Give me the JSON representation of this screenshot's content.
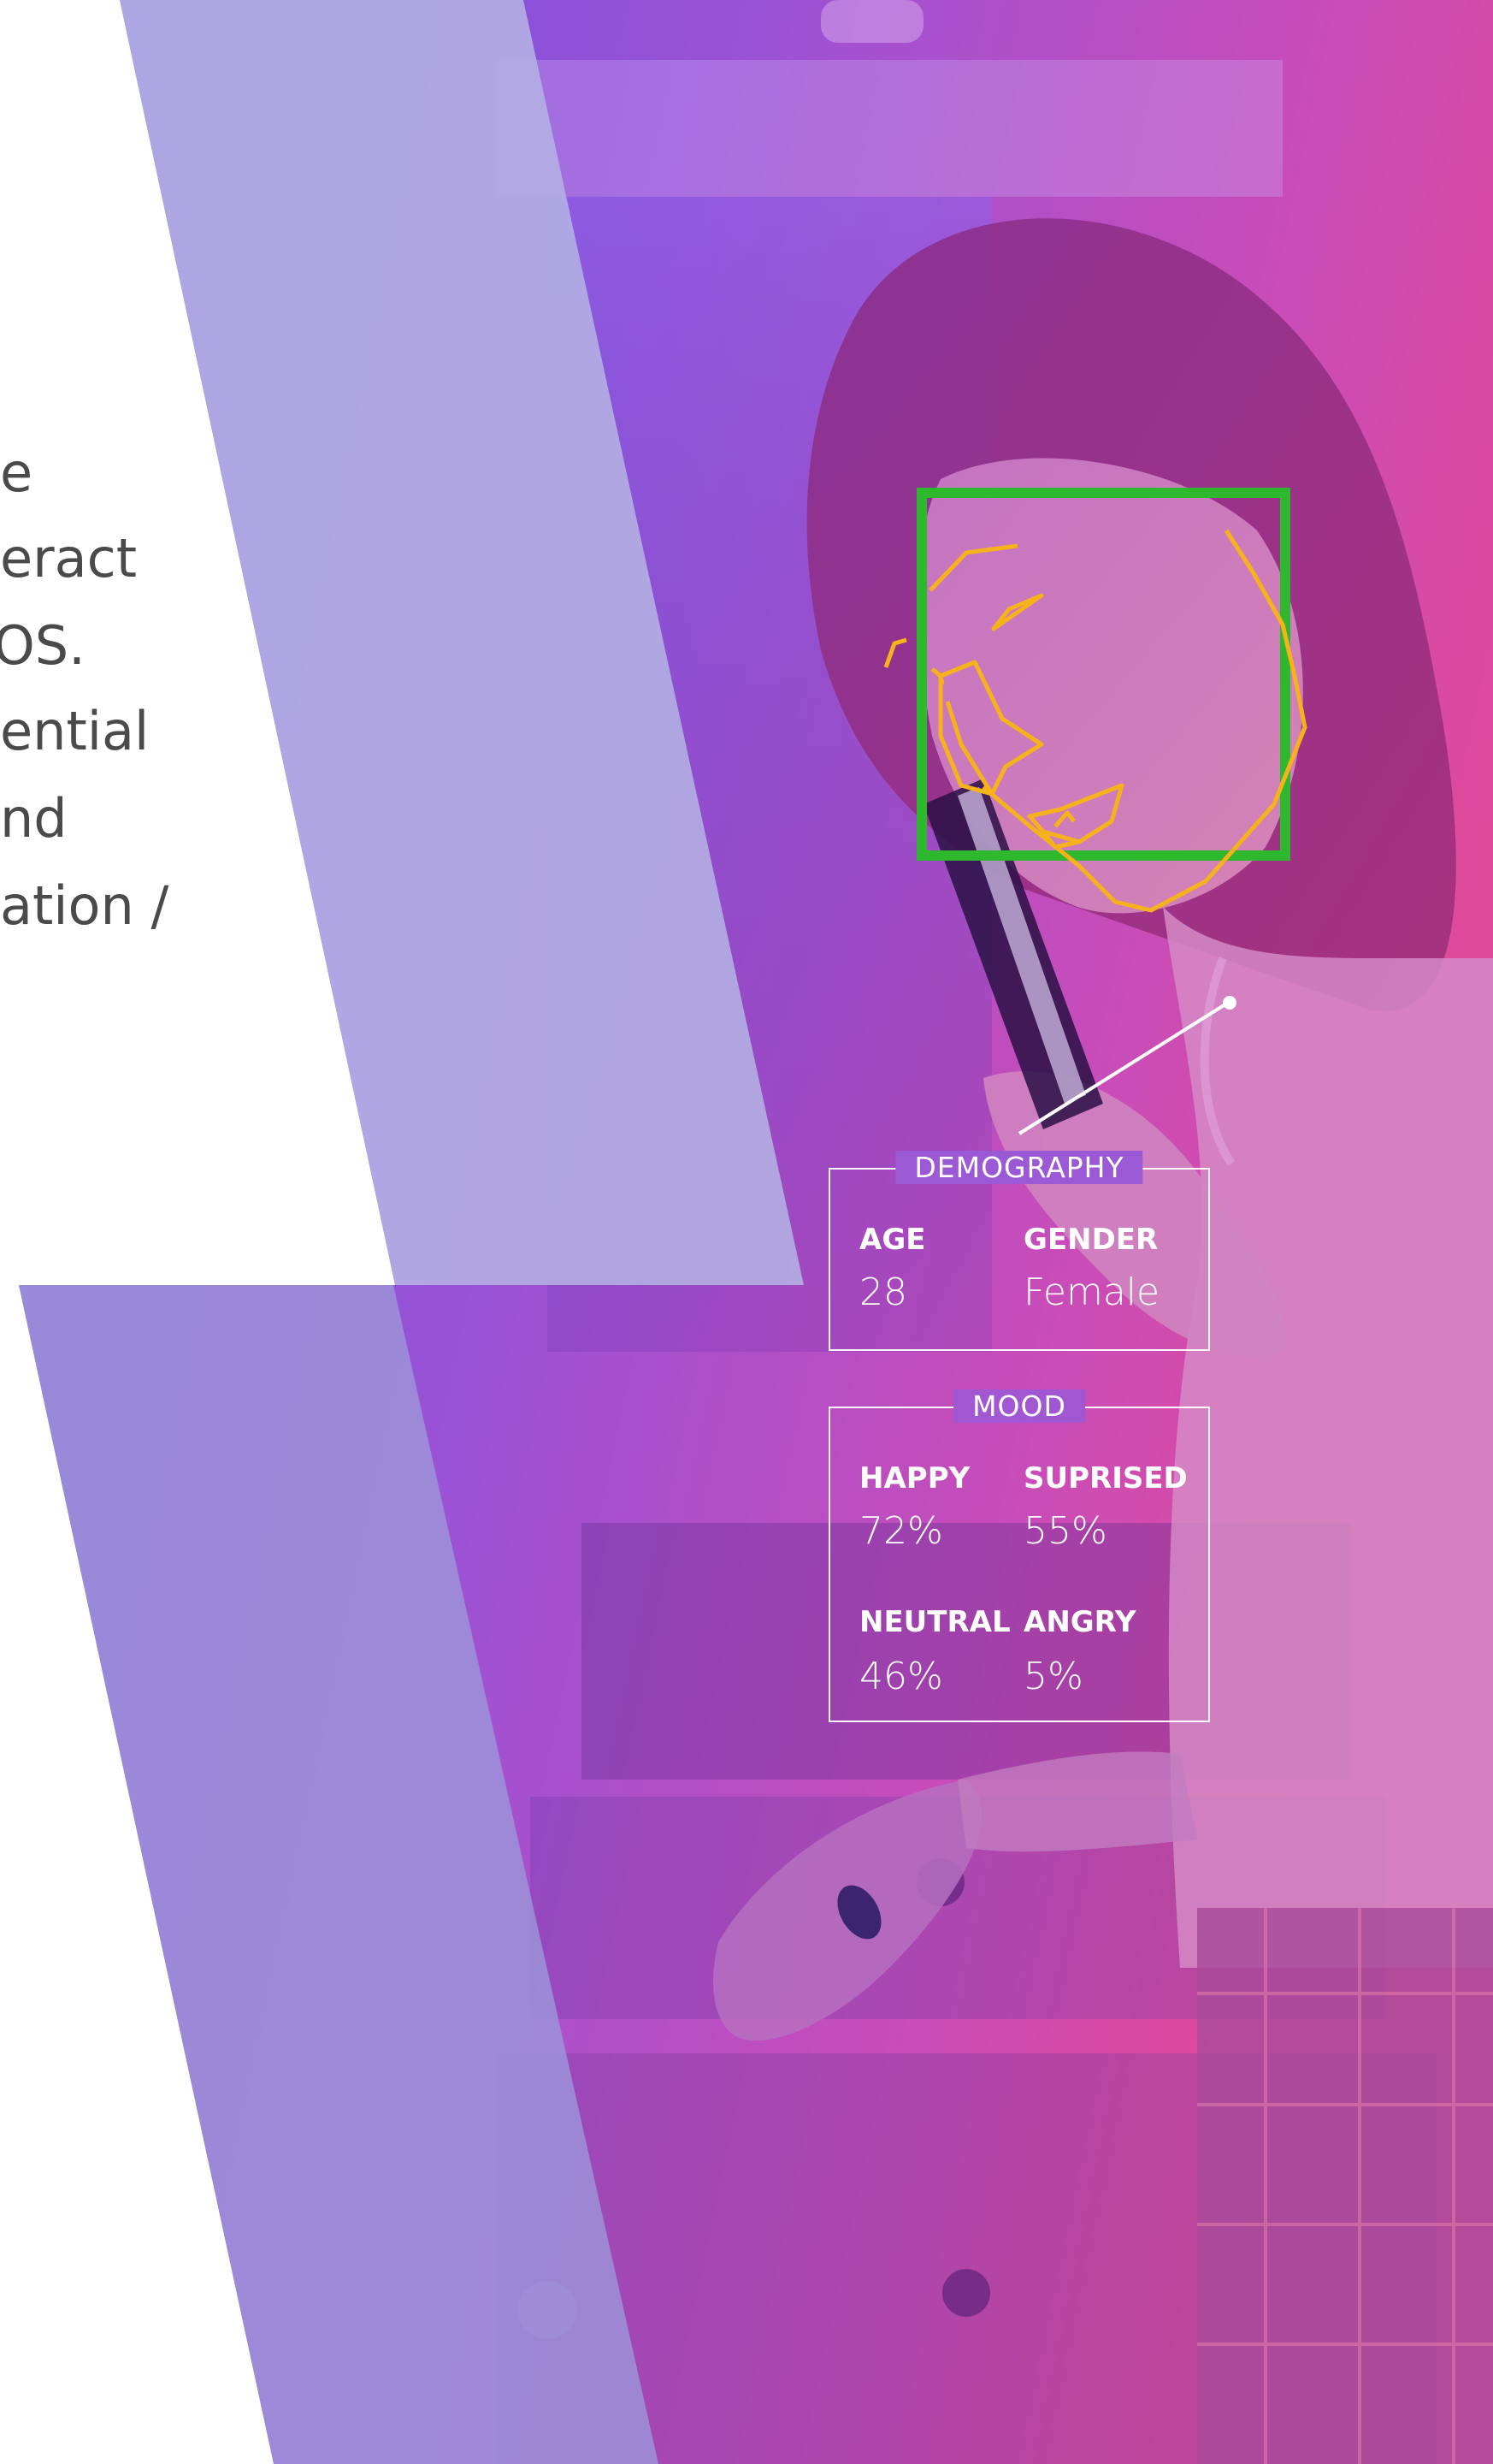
{
  "intro_text": {
    "lines": [
      "e",
      "eract",
      "OS.",
      "ential",
      "nd",
      "ation /"
    ]
  },
  "demography": {
    "title": "DEMOGRAPHY",
    "age_label": "AGE",
    "age_value": "28",
    "gender_label": "GENDER",
    "gender_value": "Female"
  },
  "mood": {
    "title": "MOOD",
    "items": [
      {
        "label": "HAPPY",
        "value": "72%"
      },
      {
        "label": "SUPRISED",
        "value": "55%"
      },
      {
        "label": "NEUTRAL",
        "value": "46%"
      },
      {
        "label": "ANGRY",
        "value": "5%"
      }
    ]
  },
  "colors": {
    "face_box": "#2db82d",
    "landmarks": "#f5b21b",
    "overlay_purple": "#7a4fe0",
    "overlay_pink": "#e0449c"
  }
}
